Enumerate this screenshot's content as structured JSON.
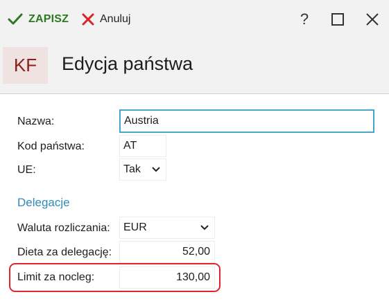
{
  "toolbar": {
    "save_label": "ZAPISZ",
    "cancel_label": "Anuluj",
    "help_label": "?"
  },
  "header": {
    "logo": "KF",
    "title": "Edycja państwa"
  },
  "form": {
    "name_label": "Nazwa:",
    "name_value": "Austria",
    "code_label": "Kod państwa:",
    "code_value": "AT",
    "eu_label": "UE:",
    "eu_value": "Tak",
    "section_label": "Delegacje",
    "currency_label": "Waluta rozliczania:",
    "currency_value": "EUR",
    "diet_label": "Dieta za delegację:",
    "diet_value": "52,00",
    "limit_label": "Limit za nocleg:",
    "limit_value": "130,00"
  },
  "colors": {
    "save": "#2b7a1f",
    "cancel_icon": "#d8232a",
    "logo_text": "#8b1f1a",
    "logo_bg": "#f0e2e0",
    "section": "#2f8bb4",
    "focus_border": "#4aa3c8",
    "highlight": "#e0242a"
  }
}
